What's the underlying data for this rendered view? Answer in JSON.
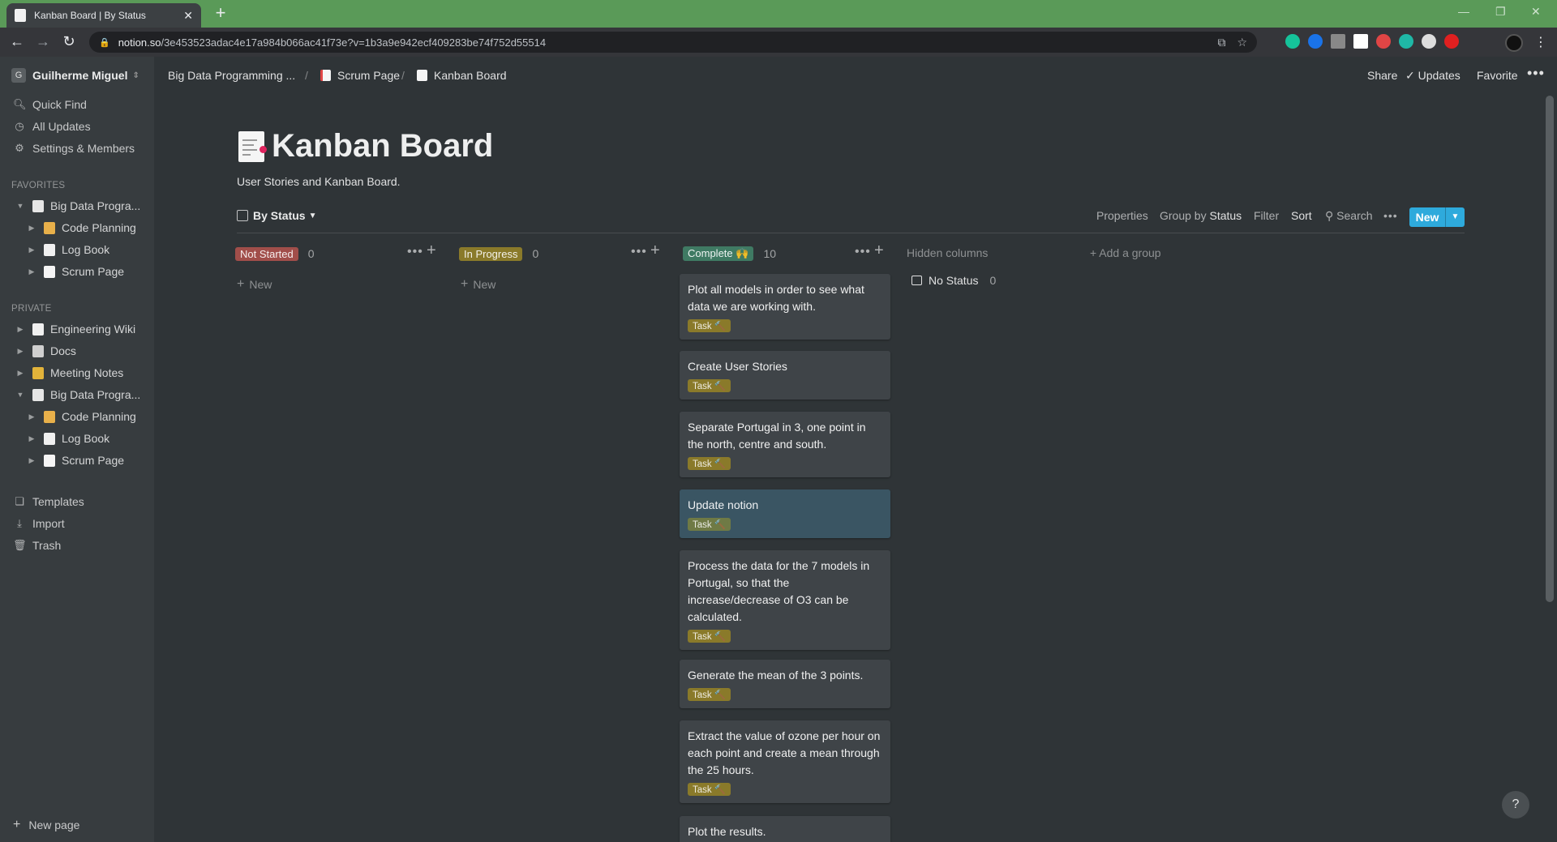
{
  "browser": {
    "tab_title": "Kanban Board | By Status",
    "url_host": "notion.so",
    "url_path": "/3e453523adac4e17a984b066ac41f73e?v=1b3a9e942ecf409283be74f752d55514"
  },
  "sidebar": {
    "workspace": "Guilherme Miguel",
    "workspace_initial": "G",
    "quick_find": "Quick Find",
    "all_updates": "All Updates",
    "settings": "Settings & Members",
    "favorites_header": "FAVORITES",
    "favorites": [
      {
        "label": "Big Data Progra...",
        "level": 0,
        "expanded": true,
        "icon": "page-icon"
      },
      {
        "label": "Code Planning",
        "level": 1,
        "icon": "person-laptop-icon"
      },
      {
        "label": "Log Book",
        "level": 1,
        "icon": "notebook-icon"
      },
      {
        "label": "Scrum Page",
        "level": 1,
        "icon": "chart-icon"
      }
    ],
    "private_header": "PRIVATE",
    "private": [
      {
        "label": "Engineering Wiki",
        "level": 0,
        "icon": "book-icon"
      },
      {
        "label": "Docs",
        "level": 0,
        "icon": "pin-icon"
      },
      {
        "label": "Meeting Notes",
        "level": 0,
        "icon": "pencil-icon"
      },
      {
        "label": "Big Data Progra...",
        "level": 0,
        "expanded": true,
        "icon": "page-icon"
      },
      {
        "label": "Code Planning",
        "level": 1,
        "icon": "person-laptop-icon"
      },
      {
        "label": "Log Book",
        "level": 1,
        "icon": "notebook-icon"
      },
      {
        "label": "Scrum Page",
        "level": 1,
        "icon": "chart-icon"
      }
    ],
    "templates": "Templates",
    "import": "Import",
    "trash": "Trash",
    "new_page": "New page"
  },
  "topbar": {
    "crumb1": "Big Data Programming ...",
    "crumb2": "Scrum Page",
    "crumb3": "Kanban Board",
    "share": "Share",
    "updates": "Updates",
    "favorite": "Favorite"
  },
  "page": {
    "title": "Kanban Board",
    "description": "User Stories and Kanban Board."
  },
  "view": {
    "name": "By Status",
    "properties": "Properties",
    "group_by_label": "Group by",
    "group_by_value": "Status",
    "filter": "Filter",
    "sort": "Sort",
    "search": "Search",
    "new": "New"
  },
  "columns": [
    {
      "label": "Not Started",
      "count": "0",
      "color": "#a14e4a",
      "new": "New"
    },
    {
      "label": "In Progress",
      "count": "0",
      "color": "#8a7a2a",
      "new": "New"
    },
    {
      "label": "Complete 🙌",
      "count": "10",
      "color": "#3f7a63"
    }
  ],
  "hidden_columns": "Hidden columns",
  "no_status": {
    "label": "No Status",
    "count": "0"
  },
  "add_group": "Add a group",
  "cards": [
    {
      "title": "Plot all models in order to see what data we are working with.",
      "tag": "Task 🔨"
    },
    {
      "title": "Create User Stories",
      "tag": "Task 🔨"
    },
    {
      "title": "Separate Portugal in 3, one point in the north, centre and south.",
      "tag": "Task 🔨"
    },
    {
      "title": "Update notion",
      "tag": "Task 🔨"
    },
    {
      "title": "Process the data for the 7 models in Portugal, so that the increase/decrease of O3 can be calculated.",
      "tag": "Task 🔨"
    },
    {
      "title": "Generate the mean of the 3 points.",
      "tag": "Task 🔨"
    },
    {
      "title": "Extract the value of ozone per hour on each point and create a mean through the 25 hours.",
      "tag": "Task 🔨"
    },
    {
      "title": "Plot the results."
    }
  ],
  "help": "?"
}
